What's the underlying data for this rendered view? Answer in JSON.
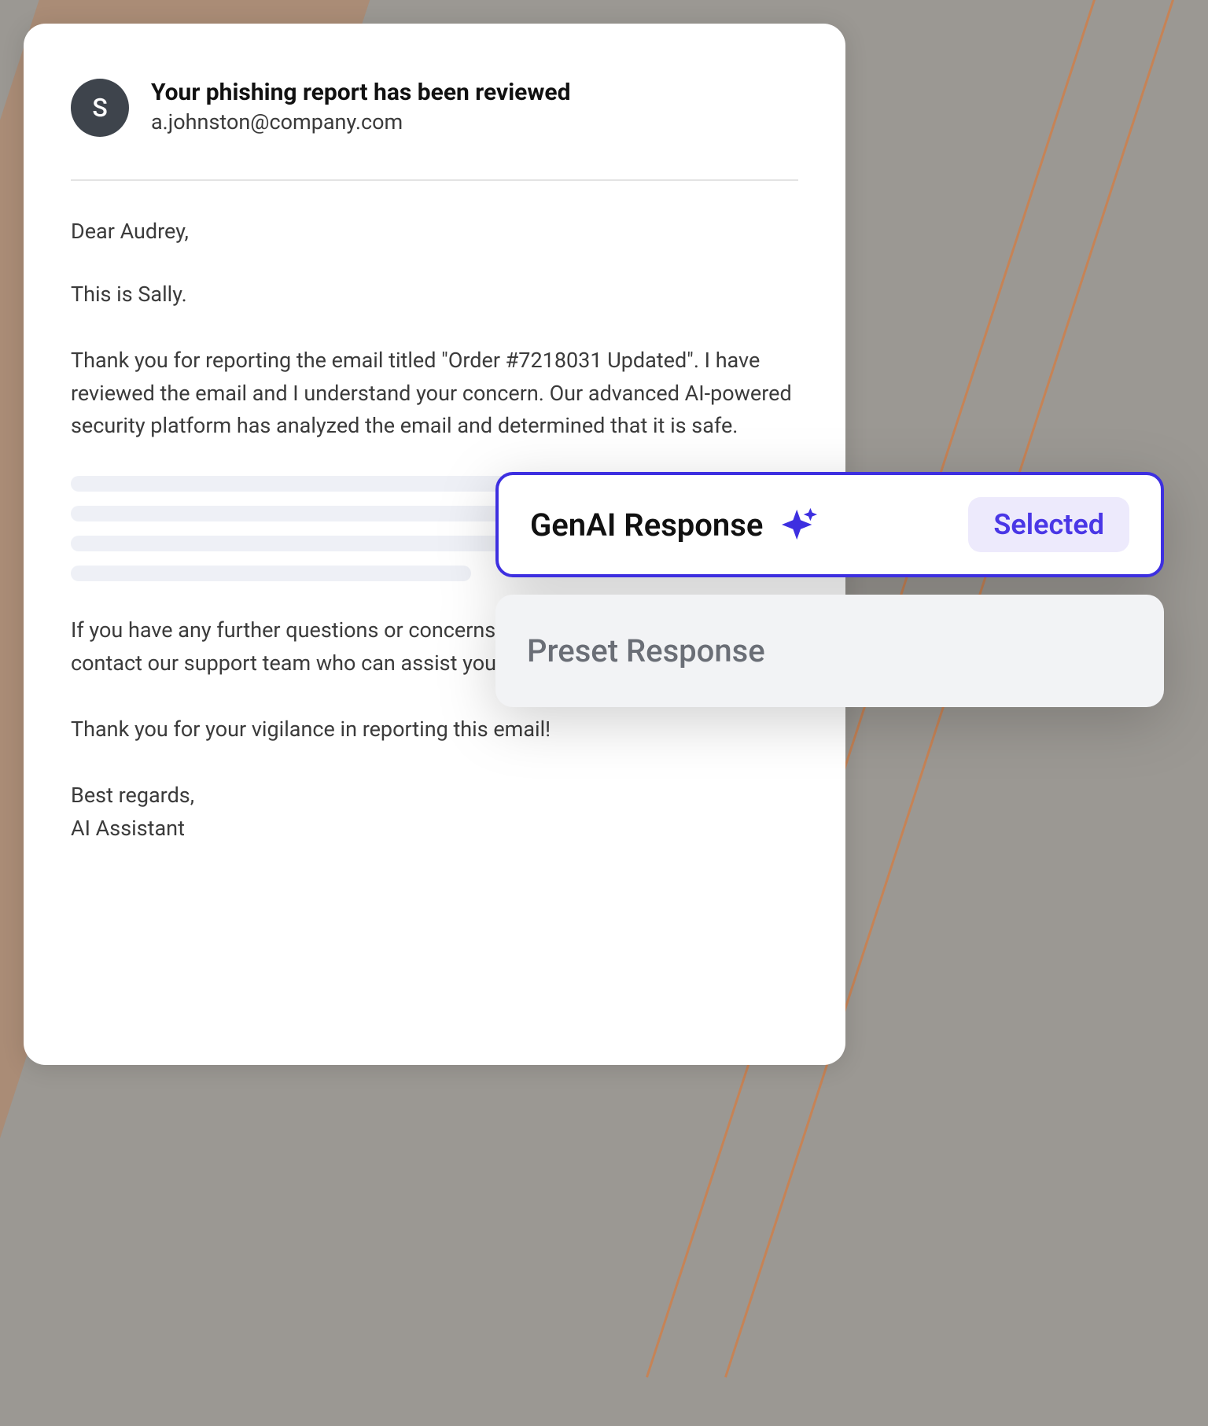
{
  "email": {
    "avatar_letter": "S",
    "subject": "Your phishing report has been reviewed",
    "from": "a.johnston@company.com",
    "greeting": "Dear Audrey,",
    "intro": "This is Sally.",
    "para1": "Thank you for reporting the email titled \"Order #7218031 Updated\". I have reviewed the email and I understand your concern. Our advanced AI-powered security platform has analyzed the email and determined that it is safe.",
    "para2": "If you have any further questions or concerns, please reply to this email or contact our support team who can assist you.",
    "thanks": "Thank you for your vigilance in reporting this email!",
    "signoff": "Best regards,",
    "signature": "AI Assistant"
  },
  "dropdown": {
    "option_selected_label": "GenAI Response",
    "option_selected_badge": "Selected",
    "option_secondary_label": "Preset Response"
  },
  "colors": {
    "accent": "#3d2fe0",
    "badge_bg": "#edeafc"
  }
}
